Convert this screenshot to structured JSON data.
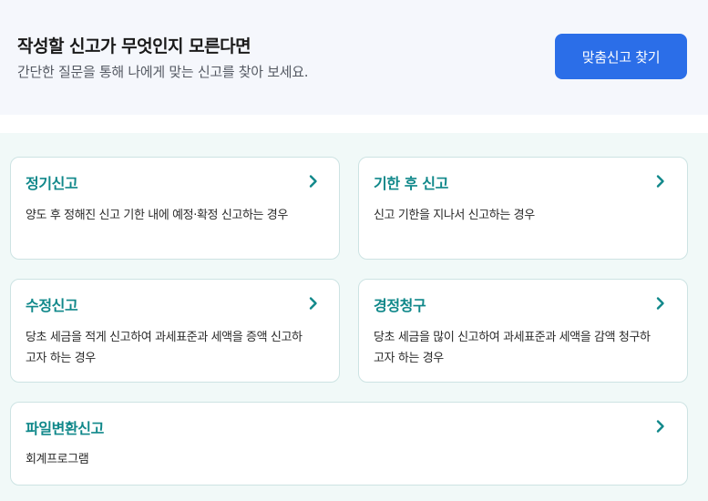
{
  "banner": {
    "title": "작성할 신고가 무엇인지 모른다면",
    "subtitle": "간단한 질문을 통해 나에게 맞는 신고를 찾아 보세요.",
    "button_label": "맞춤신고 찾기"
  },
  "cards": [
    {
      "title": "정기신고",
      "desc": "양도 후 정해진 신고 기한 내에 예정·확정 신고하는 경우",
      "icon": "chevron-right-icon"
    },
    {
      "title": "기한 후 신고",
      "desc": "신고 기한을 지나서 신고하는 경우",
      "icon": "chevron-right-icon"
    },
    {
      "title": "수정신고",
      "desc": "당초 세금을 적게 신고하여 과세표준과 세액을 증액 신고하고자 하는 경우",
      "icon": "chevron-right-icon"
    },
    {
      "title": "경정청구",
      "desc": "당초 세금을 많이 신고하여 과세표준과 세액을 감액 청구하고자 하는 경우",
      "icon": "chevron-right-icon"
    },
    {
      "title": "파일변환신고",
      "desc": "회계프로그램",
      "icon": "chevron-right-icon"
    }
  ],
  "colors": {
    "accent": "#10888a",
    "button": "#2b6ee8",
    "banner_bg": "#f5f7fc",
    "content_bg": "#f1f9f8"
  }
}
